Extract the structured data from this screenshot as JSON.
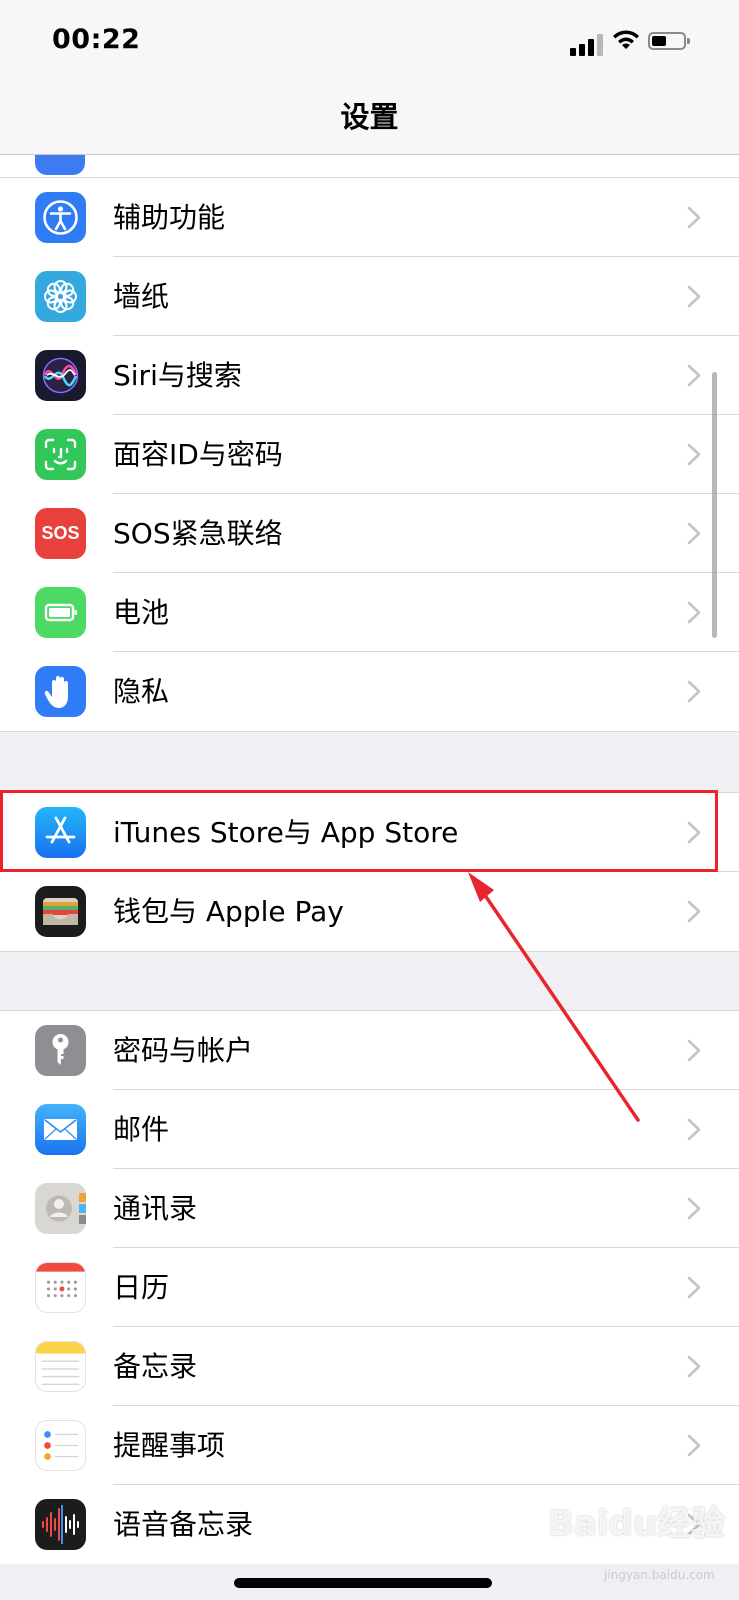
{
  "status_bar": {
    "time": "00:22"
  },
  "nav": {
    "title": "设置"
  },
  "groups": [
    {
      "items": [
        {
          "label": "辅助功能",
          "icon": "accessibility-icon",
          "color": "#2f7cf6"
        },
        {
          "label": "墙纸",
          "icon": "wallpaper-flower-icon",
          "color": "#34a9e0"
        },
        {
          "label": "Siri与搜索",
          "icon": "siri-icon",
          "color": "#1a1a2e"
        },
        {
          "label": "面容ID与密码",
          "icon": "face-id-icon",
          "color": "#33c759"
        },
        {
          "label": "SOS紧急联络",
          "icon": "sos-icon",
          "icon_text": "SOS",
          "color": "#e8403a"
        },
        {
          "label": "电池",
          "icon": "battery-icon",
          "color": "#4cd964"
        },
        {
          "label": "隐私",
          "icon": "privacy-hand-icon",
          "color": "#2f7cf6"
        }
      ]
    },
    {
      "items": [
        {
          "label": "iTunes Store与 App Store",
          "icon": "app-store-icon",
          "color": "#1a8cf7"
        },
        {
          "label": "钱包与 Apple Pay",
          "icon": "wallet-icon",
          "color": "#1c1c1c"
        }
      ]
    },
    {
      "items": [
        {
          "label": "密码与帐户",
          "icon": "key-icon",
          "color": "#8e8e93"
        },
        {
          "label": "邮件",
          "icon": "mail-icon",
          "color": "#2d8df5"
        },
        {
          "label": "通讯录",
          "icon": "contacts-icon",
          "color": "#d9d9d9"
        },
        {
          "label": "日历",
          "icon": "calendar-icon",
          "color": "#ffffff"
        },
        {
          "label": "备忘录",
          "icon": "notes-icon",
          "color": "#ffffff"
        },
        {
          "label": "提醒事项",
          "icon": "reminders-icon",
          "color": "#ffffff"
        },
        {
          "label": "语音备忘录",
          "icon": "voice-memos-icon",
          "color": "#1c1c1c"
        }
      ]
    }
  ],
  "annotation": {
    "highlight_color": "#e8252b",
    "highlighted_item": "iTunes Store与 App Store"
  },
  "watermark": {
    "text": "Baidu经验",
    "sub": "jingyan.baidu.com"
  }
}
